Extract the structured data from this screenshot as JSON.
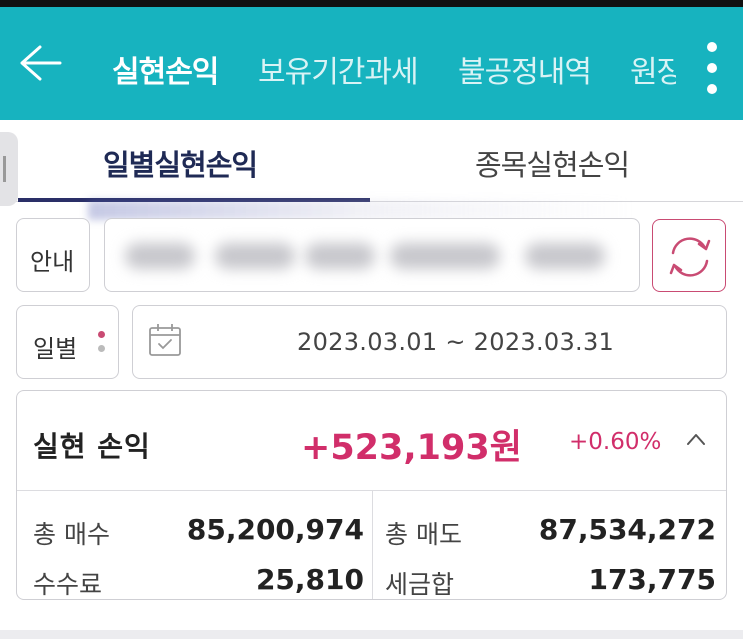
{
  "header": {
    "tabs": [
      {
        "label": "실현손익",
        "active": true
      },
      {
        "label": "보유기간과세",
        "active": false
      },
      {
        "label": "불공정내역",
        "active": false
      },
      {
        "label": "원장",
        "active": false
      }
    ]
  },
  "subtabs": {
    "daily": "일별실현손익",
    "by_stock": "종목실현손익"
  },
  "filters": {
    "info_label": "안내",
    "period_label": "일별",
    "date_range": "2023.03.01 ~ 2023.03.31"
  },
  "summary": {
    "label": "실현 손익",
    "value": "+523,193원",
    "percent": "+0.60%",
    "total_buy_label": "총 매수",
    "total_buy": "85,200,974",
    "total_sell_label": "총 매도",
    "total_sell": "87,534,272",
    "fee_label": "수수료",
    "fee": "25,810",
    "tax_label": "세금합",
    "tax": "173,775"
  },
  "colors": {
    "header_bg": "#17b3bf",
    "accent_navy": "#2a2f67",
    "profit_pink": "#d12e6a"
  }
}
